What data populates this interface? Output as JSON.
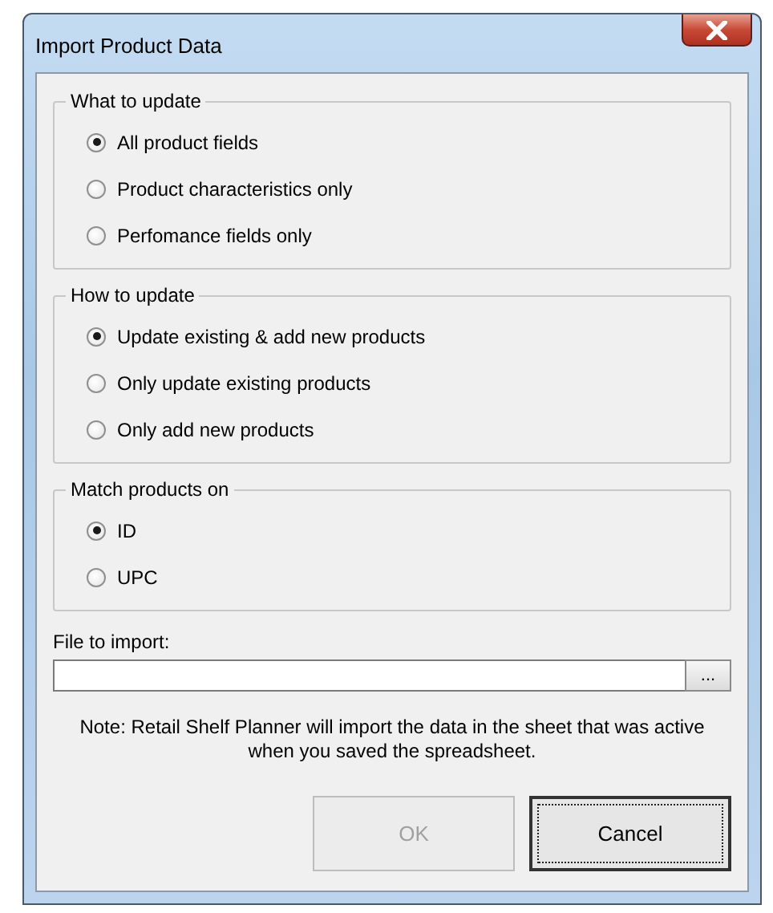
{
  "window": {
    "title": "Import Product Data"
  },
  "groups": [
    {
      "label": "What to update",
      "options": [
        {
          "label": "All product fields",
          "selected": true
        },
        {
          "label": "Product characteristics only",
          "selected": false
        },
        {
          "label": "Perfomance fields only",
          "selected": false
        }
      ]
    },
    {
      "label": "How to update",
      "options": [
        {
          "label": "Update existing & add new products",
          "selected": true
        },
        {
          "label": "Only update existing products",
          "selected": false
        },
        {
          "label": "Only add new products",
          "selected": false
        }
      ]
    },
    {
      "label": "Match products on",
      "options": [
        {
          "label": "ID",
          "selected": true
        },
        {
          "label": "UPC",
          "selected": false
        }
      ]
    }
  ],
  "file": {
    "label": "File to import:",
    "browse": "..."
  },
  "note": "Note: Retail Shelf Planner will import the data in the sheet that was active when you saved the spreadsheet.",
  "buttons": [
    {
      "label": "OK",
      "disabled": true,
      "focused": false
    },
    {
      "label": "Cancel",
      "disabled": false,
      "focused": true
    }
  ]
}
